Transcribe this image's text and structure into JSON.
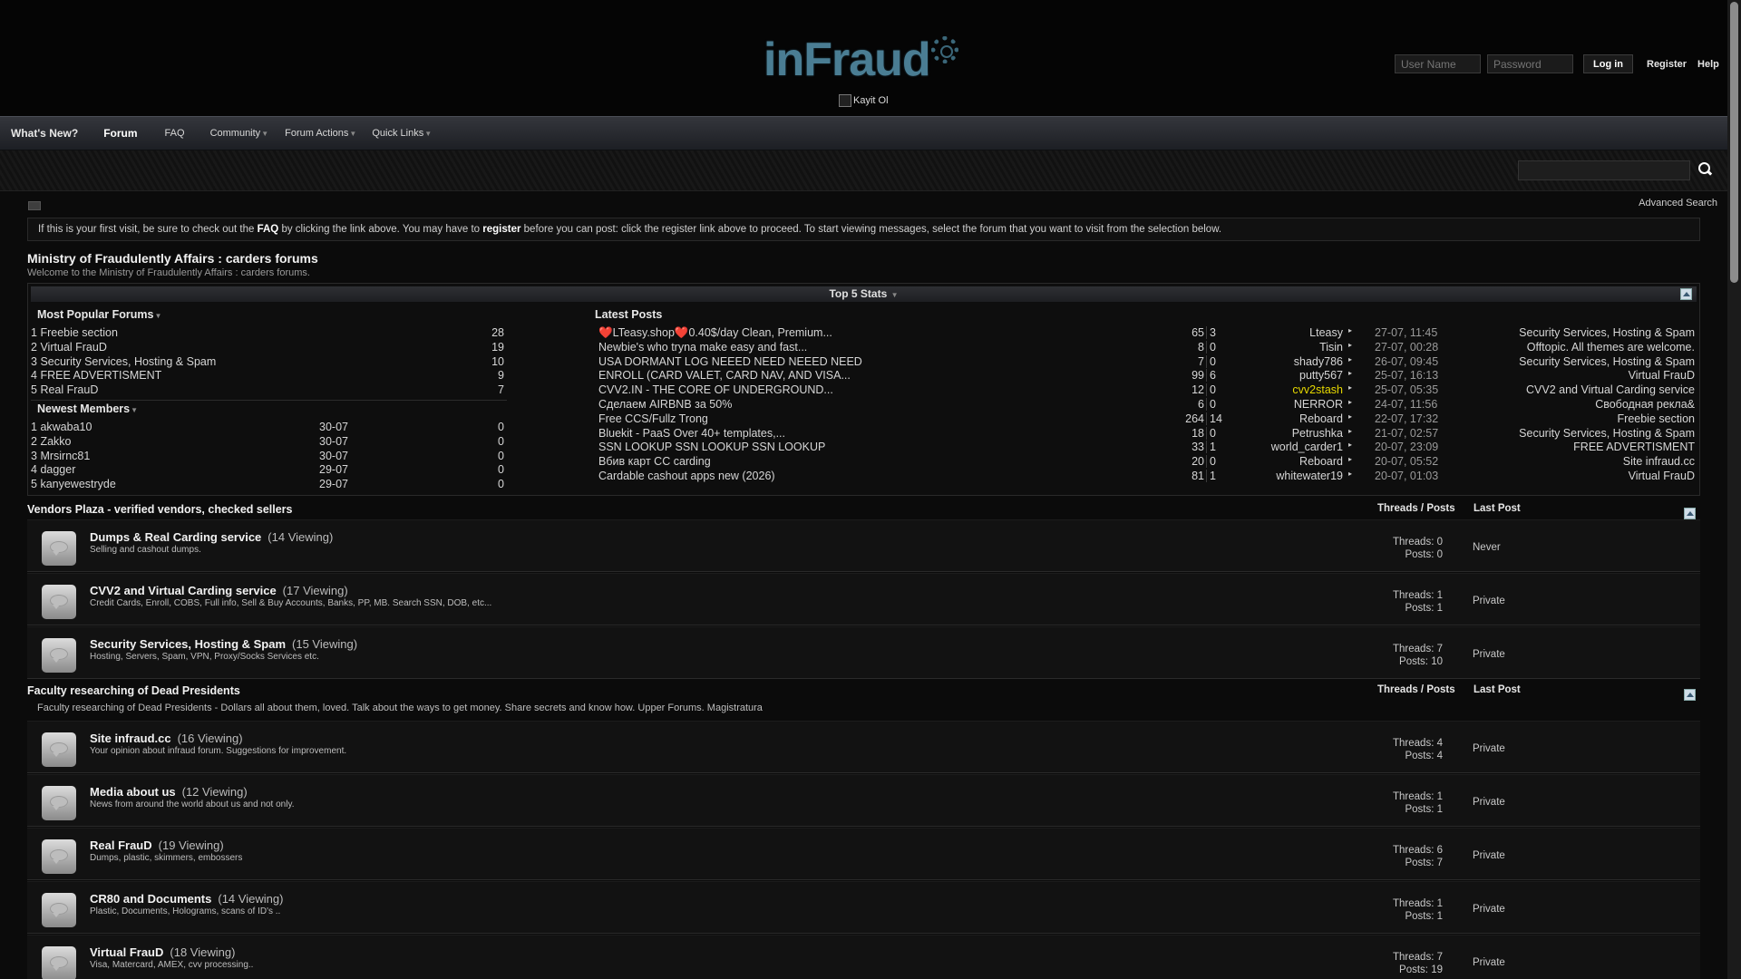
{
  "header": {
    "logo_text": "inFraud",
    "banner_alt": "Kayit Ol",
    "username_placeholder": "User Name",
    "password_placeholder": "Password",
    "login_label": "Log in",
    "register_label": "Register",
    "help_label": "Help"
  },
  "nav": {
    "whats_new": "What's New?",
    "forum": "Forum",
    "faq": "FAQ",
    "community": "Community",
    "forum_actions": "Forum Actions",
    "quick_links": "Quick Links",
    "advanced_search": "Advanced Search"
  },
  "notice": {
    "part1": "If this is your first visit, be sure to check out the ",
    "faq": "FAQ",
    "part2": " by clicking the link above. You may have to ",
    "register": "register",
    "part3": " before you can post: click the register link above to proceed. To start viewing messages, select the forum that you want to visit from the selection below."
  },
  "page": {
    "title": "Ministry of Fraudulently Affairs : carders forums",
    "desc": "Welcome to the Ministry of Fraudulently Affairs : carders forums."
  },
  "stats": {
    "title": "Top 5 Stats",
    "popular_title": "Most Popular Forums",
    "popular": [
      {
        "rank": "1",
        "name": "Freebie section",
        "count": "28"
      },
      {
        "rank": "2",
        "name": "Virtual FrauD",
        "count": "19"
      },
      {
        "rank": "3",
        "name": "Security Services, Hosting & Spam",
        "count": "10"
      },
      {
        "rank": "4",
        "name": "FREE ADVERTISMENT",
        "count": "9"
      },
      {
        "rank": "5",
        "name": "Real FrauD",
        "count": "7"
      }
    ],
    "members_title": "Newest Members",
    "members": [
      {
        "rank": "1",
        "name": "akwaba10",
        "date": "30-07",
        "count": "0"
      },
      {
        "rank": "2",
        "name": "Zakko",
        "date": "30-07",
        "count": "0"
      },
      {
        "rank": "3",
        "name": "Mrsirnc81",
        "date": "30-07",
        "count": "0"
      },
      {
        "rank": "4",
        "name": "dagger",
        "date": "29-07",
        "count": "0"
      },
      {
        "rank": "5",
        "name": "kanyewestryde",
        "date": "29-07",
        "count": "0"
      }
    ],
    "latest_title": "Latest Posts",
    "latest": [
      {
        "title": "❤️LTeasy.shop❤️0.40$/day Clean, Premium...",
        "views": "65",
        "replies": "3",
        "user": "Lteasy",
        "date": "27-07, 11:45",
        "forum": "Security Services, Hosting & Spam"
      },
      {
        "title": "Newbie's who tryna make easy and fast...",
        "views": "8",
        "replies": "0",
        "user": "Tisin",
        "date": "27-07, 00:28",
        "forum": "Offtopic. All themes are welcome."
      },
      {
        "title": "USA DORMANT LOG NEEED NEED NEEED NEED",
        "views": "7",
        "replies": "0",
        "user": "shady786",
        "date": "26-07, 09:45",
        "forum": "Security Services, Hosting & Spam"
      },
      {
        "title": "ENROLL (CARD VALET, CARD NAV, AND VISA...",
        "views": "99",
        "replies": "6",
        "user": "putty567",
        "date": "25-07, 16:13",
        "forum": "Virtual FrauD"
      },
      {
        "title": "CVV2.IN - THE CORE OF UNDERGROUND...",
        "views": "12",
        "replies": "0",
        "user": "cvv2stash",
        "date": "25-07, 05:35",
        "forum": "CVV2 and Virtual Carding service"
      },
      {
        "title": "Сделаем AIRBNB за 50%",
        "views": "6",
        "replies": "0",
        "user": "NERROR",
        "date": "24-07, 11:56",
        "forum": "Свободная рекла&"
      },
      {
        "title": "Free CCS/Fullz Trong",
        "views": "264",
        "replies": "14",
        "user": "Reboard",
        "date": "22-07, 17:32",
        "forum": "Freebie section"
      },
      {
        "title": "Bluekit - PaaS Over 40+ templates,...",
        "views": "18",
        "replies": "0",
        "user": "Petrushka",
        "date": "21-07, 02:57",
        "forum": "Security Services, Hosting & Spam"
      },
      {
        "title": "SSN LOOKUP SSN LOOKUP SSN LOOKUP",
        "views": "33",
        "replies": "1",
        "user": "world_carder1",
        "date": "20-07, 23:09",
        "forum": "FREE ADVERTISMENT"
      },
      {
        "title": "Вбив карт CC carding",
        "views": "20",
        "replies": "0",
        "user": "Reboard",
        "date": "20-07, 05:52",
        "forum": "Site infraud.cc"
      },
      {
        "title": "Cardable cashout apps new (2026)",
        "views": "81",
        "replies": "1",
        "user": "whitewater19",
        "date": "20-07, 01:03",
        "forum": "Virtual FrauD"
      }
    ],
    "highlight_color": "#e6d800"
  },
  "sections": [
    {
      "title": "Vendors Plaza - verified vendors, checked sellers",
      "col_threads": "Threads / Posts",
      "col_last": "Last Post",
      "desc": "",
      "forums": [
        {
          "name": "Dumps & Real Carding service",
          "viewing": "(14 Viewing)",
          "sub": "Selling and cashout dumps.",
          "threads": "Threads: 0",
          "posts": "Posts: 0",
          "last": "Never"
        },
        {
          "name": "CVV2 and Virtual Carding service",
          "viewing": "(17 Viewing)",
          "sub": "Credit Cards, Enroll, COBS, Full info, Sell & Buy Accounts, Banks, PP, MB. Search SSN, DOB, etc...",
          "threads": "Threads: 1",
          "posts": "Posts: 1",
          "last": "Private"
        },
        {
          "name": "Security Services, Hosting & Spam",
          "viewing": "(15 Viewing)",
          "sub": "Hosting, Servers, Spam, VPN, Proxy/Socks Services etc.",
          "threads": "Threads: 7",
          "posts": "Posts: 10",
          "last": "Private"
        }
      ]
    },
    {
      "title": "Faculty researching of Dead Presidents",
      "col_threads": "Threads / Posts",
      "col_last": "Last Post",
      "desc": "Faculty researching of Dead Presidents - Dollars all about them, loved. Talk about the ways to get money. Share secrets and know how. Upper Forums. Magistratura",
      "forums": [
        {
          "name": "Site infraud.cc",
          "viewing": "(16 Viewing)",
          "sub": "Your opinion about infraud forum. Suggestions for improvement.",
          "threads": "Threads: 4",
          "posts": "Posts: 4",
          "last": "Private"
        },
        {
          "name": "Media about us",
          "viewing": "(12 Viewing)",
          "sub": "News from around the world about us and not only.",
          "threads": "Threads: 1",
          "posts": "Posts: 1",
          "last": "Private"
        },
        {
          "name": "Real FrauD",
          "viewing": "(19 Viewing)",
          "sub": "Dumps, plastic, skimmers, embossers",
          "threads": "Threads: 6",
          "posts": "Posts: 7",
          "last": "Private"
        },
        {
          "name": "CR80 and Documents",
          "viewing": "(14 Viewing)",
          "sub": "Plastic, Documents, Holograms, scans of ID's ..",
          "threads": "Threads: 1",
          "posts": "Posts: 1",
          "last": "Private"
        },
        {
          "name": "Virtual FrauD",
          "viewing": "(18 Viewing)",
          "sub": "Visa, Matercard, AMEX, cvv processing..",
          "threads": "Threads: 7",
          "posts": "Posts: 19",
          "last": "Private"
        }
      ]
    }
  ]
}
